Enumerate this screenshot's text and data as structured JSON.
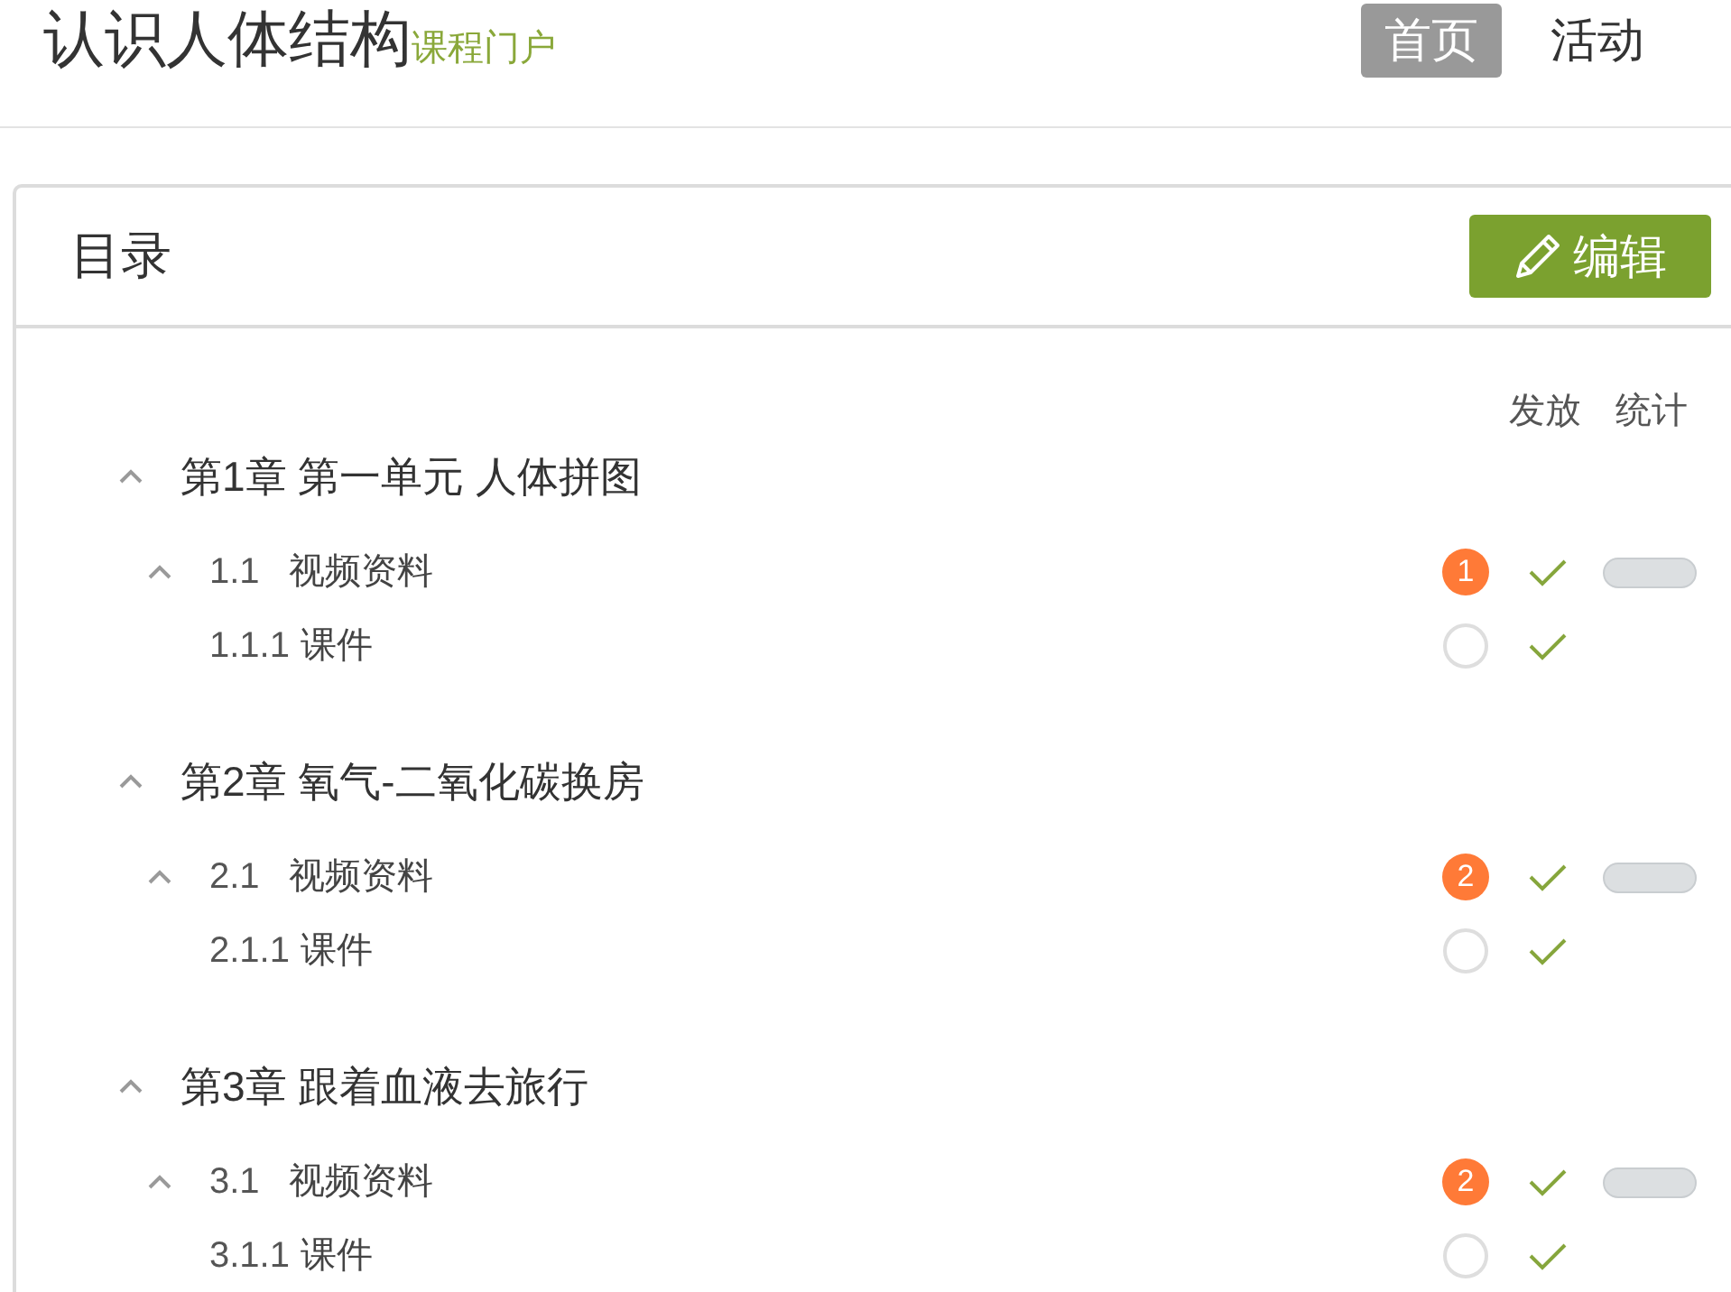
{
  "header": {
    "title": "认识人体结构",
    "subtitle": "课程门户"
  },
  "nav": [
    {
      "label": "首页",
      "selected": true
    },
    {
      "label": "活动",
      "selected": false
    }
  ],
  "catalog": {
    "title": "目录",
    "edit_button": "编辑",
    "columns": [
      "发放",
      "统计"
    ],
    "chapters": [
      {
        "label": "第1章 第一单元 人体拼图",
        "expanded": true,
        "children": [
          {
            "number": "1.1",
            "title": "视频资料",
            "expanded": true,
            "badge": "1",
            "published": true,
            "level": 0,
            "children": [
              {
                "number": "1.1.1",
                "title": "课件",
                "published": true
              }
            ]
          }
        ]
      },
      {
        "label": "第2章 氧气-二氧化碳换房",
        "expanded": true,
        "children": [
          {
            "number": "2.1",
            "title": "视频资料",
            "expanded": true,
            "badge": "2",
            "published": true,
            "level": 0,
            "children": [
              {
                "number": "2.1.1",
                "title": "课件",
                "published": true
              }
            ]
          }
        ]
      },
      {
        "label": "第3章 跟着血液去旅行",
        "expanded": true,
        "children": [
          {
            "number": "3.1",
            "title": "视频资料",
            "expanded": true,
            "badge": "2",
            "published": true,
            "level": 0,
            "children": [
              {
                "number": "3.1.1",
                "title": "课件",
                "published": true
              }
            ]
          }
        ]
      }
    ]
  }
}
